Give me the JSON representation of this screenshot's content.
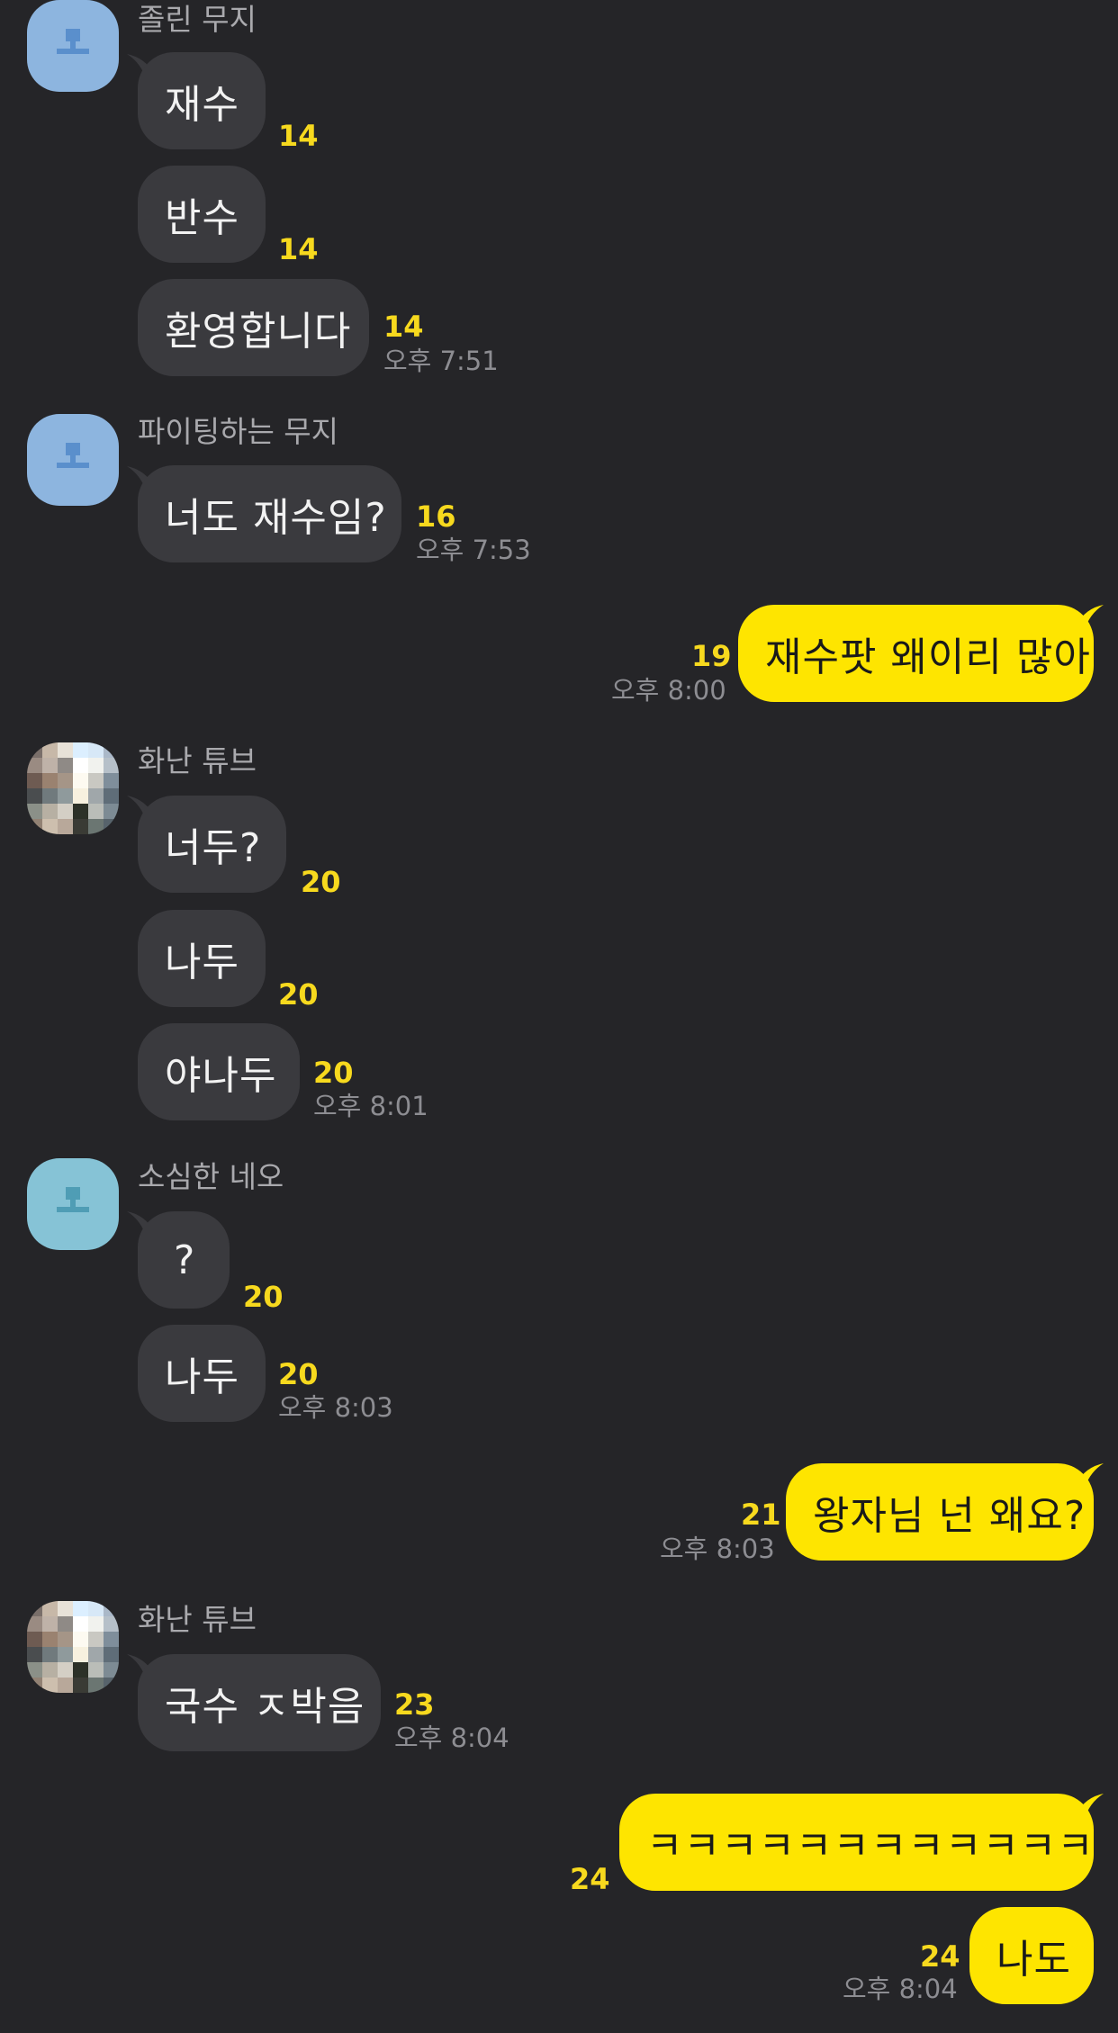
{
  "colors": {
    "background": "#252528",
    "incoming_bubble": "#3a3a3e",
    "outgoing_bubble": "#fee500",
    "unread_count": "#f7d91e",
    "sender_name": "#a9a9ad",
    "timestamp": "#8d8d92"
  },
  "messages": [
    {
      "sender": "졸린 무지",
      "avatar": "default-profile-icon",
      "text": "재수",
      "unread": "14"
    },
    {
      "text": "반수",
      "unread": "14"
    },
    {
      "text": "환영합니다",
      "unread": "14",
      "time": "오후 7:51"
    },
    {
      "sender": "파이팅하는 무지",
      "avatar": "default-profile-icon",
      "text": "너도 재수임?",
      "unread": "16",
      "time": "오후 7:53"
    },
    {
      "mine": true,
      "text": "재수팟 왜이리 많아",
      "unread": "19",
      "time": "오후 8:00"
    },
    {
      "sender": "화난 튜브",
      "avatar": "mosaic-photo",
      "text": "너두?",
      "unread": "20"
    },
    {
      "text": "나두",
      "unread": "20"
    },
    {
      "text": "야나두",
      "unread": "20",
      "time": "오후 8:01"
    },
    {
      "sender": "소심한 네오",
      "avatar": "default-profile-icon",
      "text": "?",
      "unread": "20"
    },
    {
      "text": "나두",
      "unread": "20",
      "time": "오후 8:03"
    },
    {
      "mine": true,
      "text": "왕자님 넌 왜요?",
      "unread": "21",
      "time": "오후 8:03"
    },
    {
      "sender": "화난 튜브",
      "avatar": "mosaic-photo",
      "text": "국수 ㅈ박음",
      "unread": "23",
      "time": "오후 8:04"
    },
    {
      "mine": true,
      "text": "ㅋㅋㅋㅋㅋㅋㅋㅋㅋㅋㅋㅋ",
      "unread": "24"
    },
    {
      "mine": true,
      "text": "나도",
      "unread": "24",
      "time": "오후 8:04"
    }
  ]
}
